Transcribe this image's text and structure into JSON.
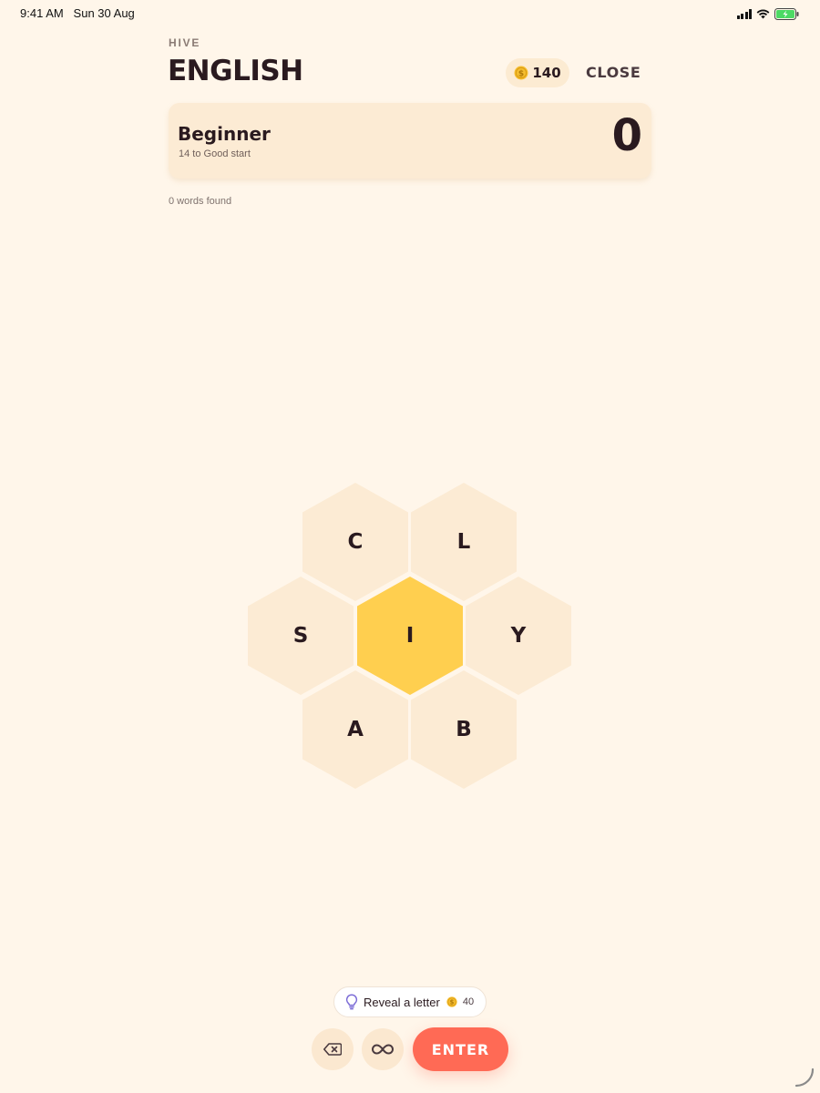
{
  "status_bar": {
    "time": "9:41 AM",
    "date": "Sun 30 Aug"
  },
  "header": {
    "eyebrow": "HIVE",
    "title": "ENGLISH",
    "coins": "140",
    "close_label": "CLOSE"
  },
  "rank": {
    "title": "Beginner",
    "subtitle": "14 to Good start",
    "score": "0"
  },
  "words_found": "0 words found",
  "hive": {
    "center": "I",
    "top_left": "C",
    "top_right": "L",
    "left": "S",
    "right": "Y",
    "bottom_left": "A",
    "bottom_right": "B"
  },
  "reveal": {
    "label": "Reveal a letter",
    "cost": "40"
  },
  "controls": {
    "enter_label": "ENTER"
  },
  "colors": {
    "background": "#FFF6EA",
    "tile": "#FCEBD4",
    "center_tile": "#FFCF4F",
    "enter": "#FF6A55",
    "coin": "#F5BE2F"
  },
  "icons": [
    "signal-icon",
    "wifi-icon",
    "battery-icon",
    "coin-icon",
    "lightbulb-icon",
    "backspace-icon",
    "infinity-icon",
    "corner-handle-icon"
  ]
}
